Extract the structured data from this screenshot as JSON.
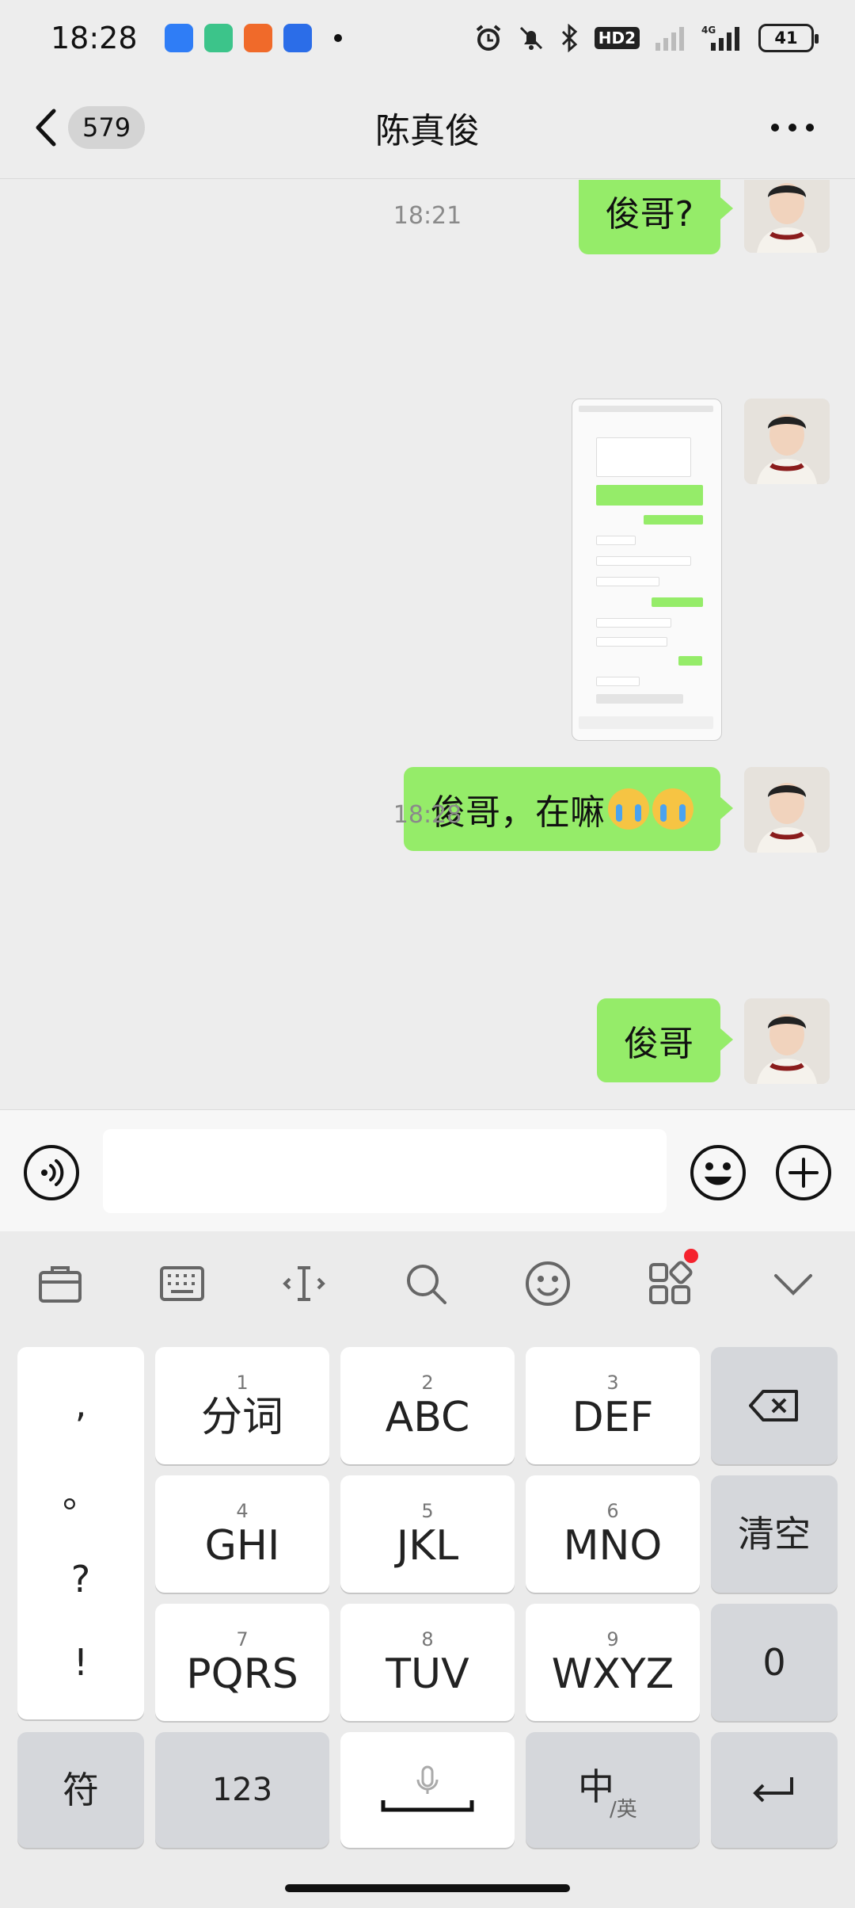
{
  "status_bar": {
    "time": "18:28",
    "battery": "41",
    "network": "4G",
    "hd_badge": "HD2"
  },
  "header": {
    "unread_count": "579",
    "title": "陈真俊"
  },
  "messages": [
    {
      "type": "text",
      "text": "俊哥?"
    },
    {
      "type": "time",
      "text": "18:21"
    },
    {
      "type": "image"
    },
    {
      "type": "text",
      "text": "俊哥，在嘛"
    },
    {
      "type": "time",
      "text": "18:28"
    },
    {
      "type": "text",
      "text": "俊哥"
    }
  ],
  "input": {
    "value": "",
    "placeholder": ""
  },
  "keyboard": {
    "punctuation": [
      ",",
      "。",
      "?",
      "!"
    ],
    "keys": [
      {
        "num": "1",
        "label": "分词"
      },
      {
        "num": "2",
        "label": "ABC"
      },
      {
        "num": "3",
        "label": "DEF"
      },
      {
        "num": "4",
        "label": "GHI"
      },
      {
        "num": "5",
        "label": "JKL"
      },
      {
        "num": "6",
        "label": "MNO"
      },
      {
        "num": "7",
        "label": "PQRS"
      },
      {
        "num": "8",
        "label": "TUV"
      },
      {
        "num": "9",
        "label": "WXYZ"
      }
    ],
    "clear_label": "清空",
    "zero_label": "0",
    "symbol_label": "符",
    "numeric_label": "123",
    "lang_main": "中",
    "lang_sub": "/英"
  },
  "colors": {
    "bubble": "#95ec69",
    "background": "#ededed",
    "notification_dot": "#f5222d"
  }
}
